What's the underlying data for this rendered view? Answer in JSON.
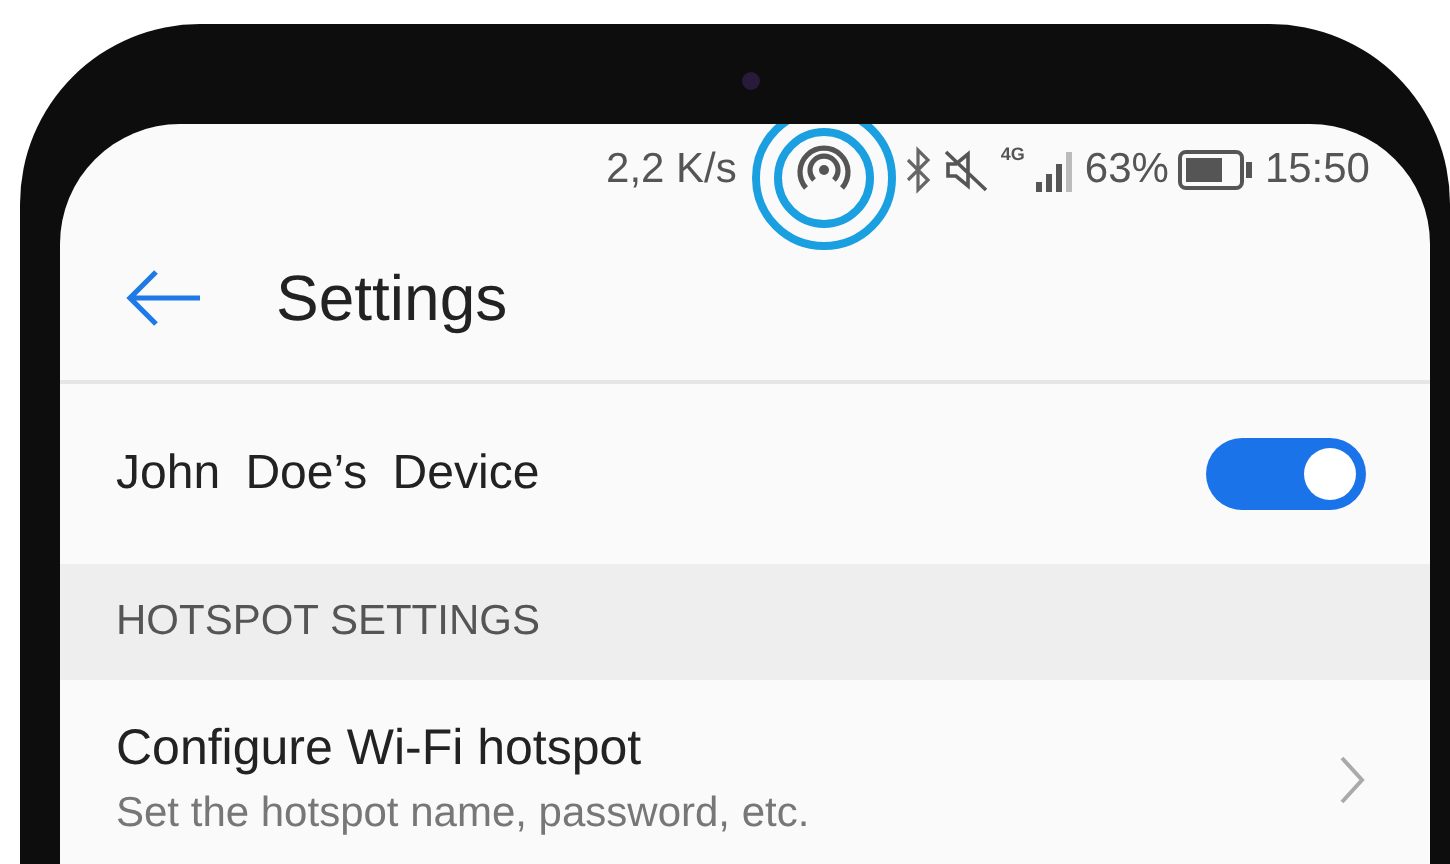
{
  "status_bar": {
    "speed": "2,2 K/s",
    "network": "4G",
    "battery": "63%",
    "time": "15:50"
  },
  "header": {
    "title": "Settings"
  },
  "device": {
    "name": "John Doe’s Device",
    "on": true
  },
  "section": {
    "title": "HOTSPOT SETTINGS"
  },
  "items": [
    {
      "title": "Configure Wi-Fi hotspot",
      "subtitle": "Set the hotspot name, password, etc."
    }
  ]
}
